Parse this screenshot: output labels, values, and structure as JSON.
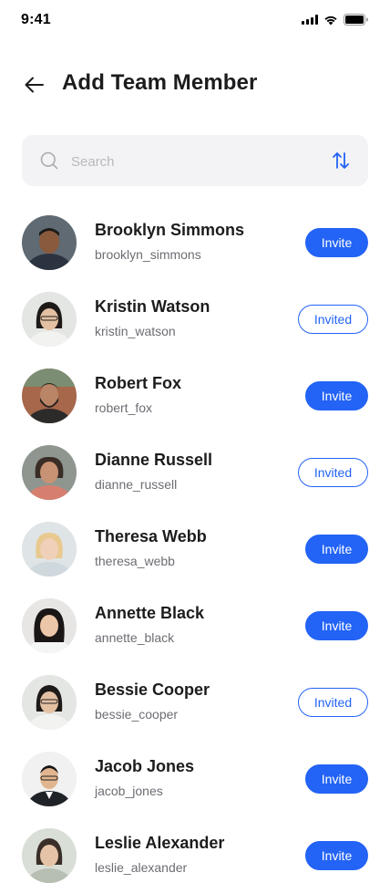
{
  "status_bar": {
    "time": "9:41"
  },
  "header": {
    "title": "Add Team Member"
  },
  "search": {
    "placeholder": "Search"
  },
  "colors": {
    "accent": "#2363f5"
  },
  "members": [
    {
      "name": "Brooklyn Simmons",
      "username": "brooklyn_simmons",
      "action": "Invite",
      "invited": false
    },
    {
      "name": "Kristin Watson",
      "username": "kristin_watson",
      "action": "Invited",
      "invited": true
    },
    {
      "name": "Robert Fox",
      "username": "robert_fox",
      "action": "Invite",
      "invited": false
    },
    {
      "name": "Dianne Russell",
      "username": "dianne_russell",
      "action": "Invited",
      "invited": true
    },
    {
      "name": "Theresa Webb",
      "username": "theresa_webb",
      "action": "Invite",
      "invited": false
    },
    {
      "name": "Annette Black",
      "username": "annette_black",
      "action": "Invite",
      "invited": false
    },
    {
      "name": "Bessie Cooper",
      "username": "bessie_cooper",
      "action": "Invited",
      "invited": true
    },
    {
      "name": "Jacob Jones",
      "username": "jacob_jones",
      "action": "Invite",
      "invited": false
    },
    {
      "name": "Leslie Alexander",
      "username": "leslie_alexander",
      "action": "Invite",
      "invited": false
    }
  ]
}
